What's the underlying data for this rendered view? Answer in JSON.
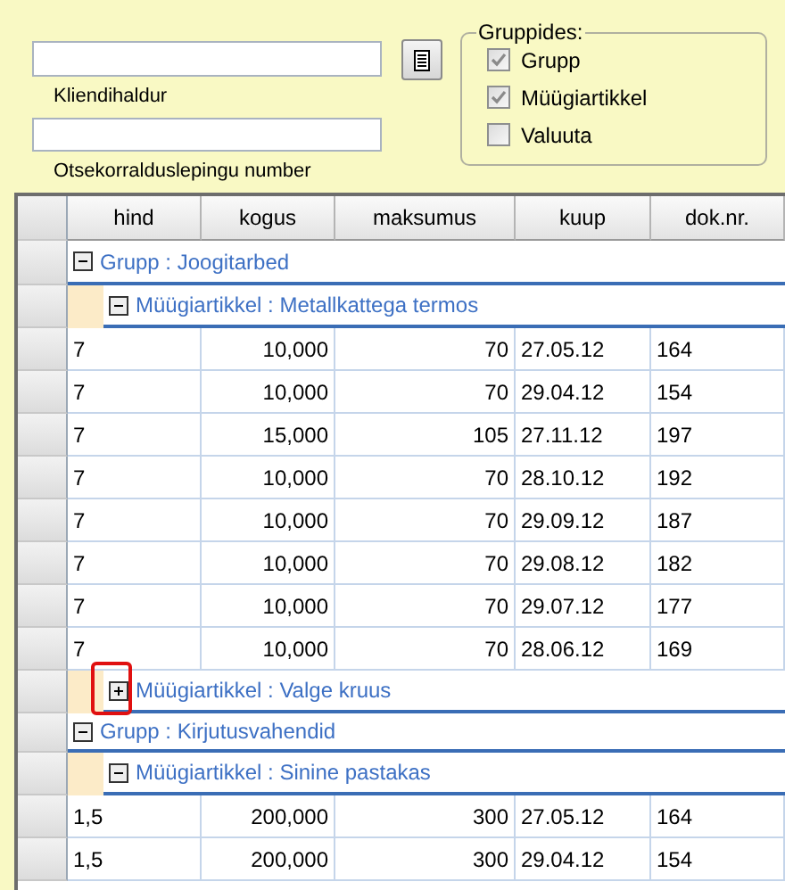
{
  "filters": {
    "fields": [
      {
        "label": "Kliendihaldur"
      },
      {
        "label": "Otsekorralduslepingu number"
      }
    ]
  },
  "group_by": {
    "title": "Gruppides:",
    "options": [
      {
        "label": "Grupp",
        "checked": true
      },
      {
        "label": "Müügiartikkel",
        "checked": true
      },
      {
        "label": "Valuuta",
        "checked": false
      }
    ]
  },
  "table": {
    "columns": [
      "hind",
      "kogus",
      "maksumus",
      "kuup",
      "dok.nr."
    ],
    "groups": [
      {
        "label": "Grupp : Joogitarbed",
        "expanded": true,
        "children": [
          {
            "label": "Müügiartikkel : Metallkattega termos",
            "expanded": true,
            "highlighted": false,
            "rows": [
              [
                "7",
                "10,000",
                "70",
                "27.05.12",
                "164"
              ],
              [
                "7",
                "10,000",
                "70",
                "29.04.12",
                "154"
              ],
              [
                "7",
                "15,000",
                "105",
                "27.11.12",
                "197"
              ],
              [
                "7",
                "10,000",
                "70",
                "28.10.12",
                "192"
              ],
              [
                "7",
                "10,000",
                "70",
                "29.09.12",
                "187"
              ],
              [
                "7",
                "10,000",
                "70",
                "29.08.12",
                "182"
              ],
              [
                "7",
                "10,000",
                "70",
                "29.07.12",
                "177"
              ],
              [
                "7",
                "10,000",
                "70",
                "28.06.12",
                "169"
              ]
            ]
          },
          {
            "label": "Müügiartikkel : Valge kruus",
            "expanded": false,
            "highlighted": true
          }
        ]
      },
      {
        "label": "Grupp : Kirjutusvahendid",
        "expanded": true,
        "children": [
          {
            "label": "Müügiartikkel : Sinine pastakas",
            "expanded": true,
            "highlighted": false,
            "rows": [
              [
                "1,5",
                "200,000",
                "300",
                "27.05.12",
                "164"
              ],
              [
                "1,5",
                "200,000",
                "300",
                "29.04.12",
                "154"
              ]
            ]
          }
        ]
      }
    ]
  }
}
